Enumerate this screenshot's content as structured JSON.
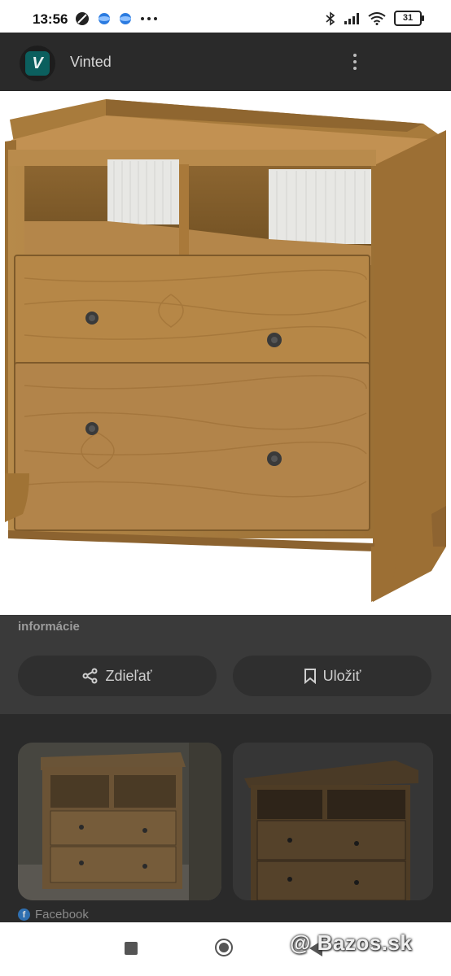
{
  "status_bar": {
    "time": "13:56",
    "battery": "31"
  },
  "header": {
    "app_title": "Vinted",
    "logo_letter": "V"
  },
  "image": {
    "subject": "wooden chest of drawers with open shelves"
  },
  "info": {
    "text": "informácie"
  },
  "actions": {
    "share_label": "Zdieľať",
    "save_label": "Uložiť"
  },
  "related": {
    "source_label": "Facebook"
  },
  "watermark": {
    "text": "Bazos.sk"
  },
  "colors": {
    "wood": "#a57a3e",
    "wood_dark": "#7e5a2a",
    "knob": "#3a3a3a",
    "accent": "#0b5f5e"
  }
}
